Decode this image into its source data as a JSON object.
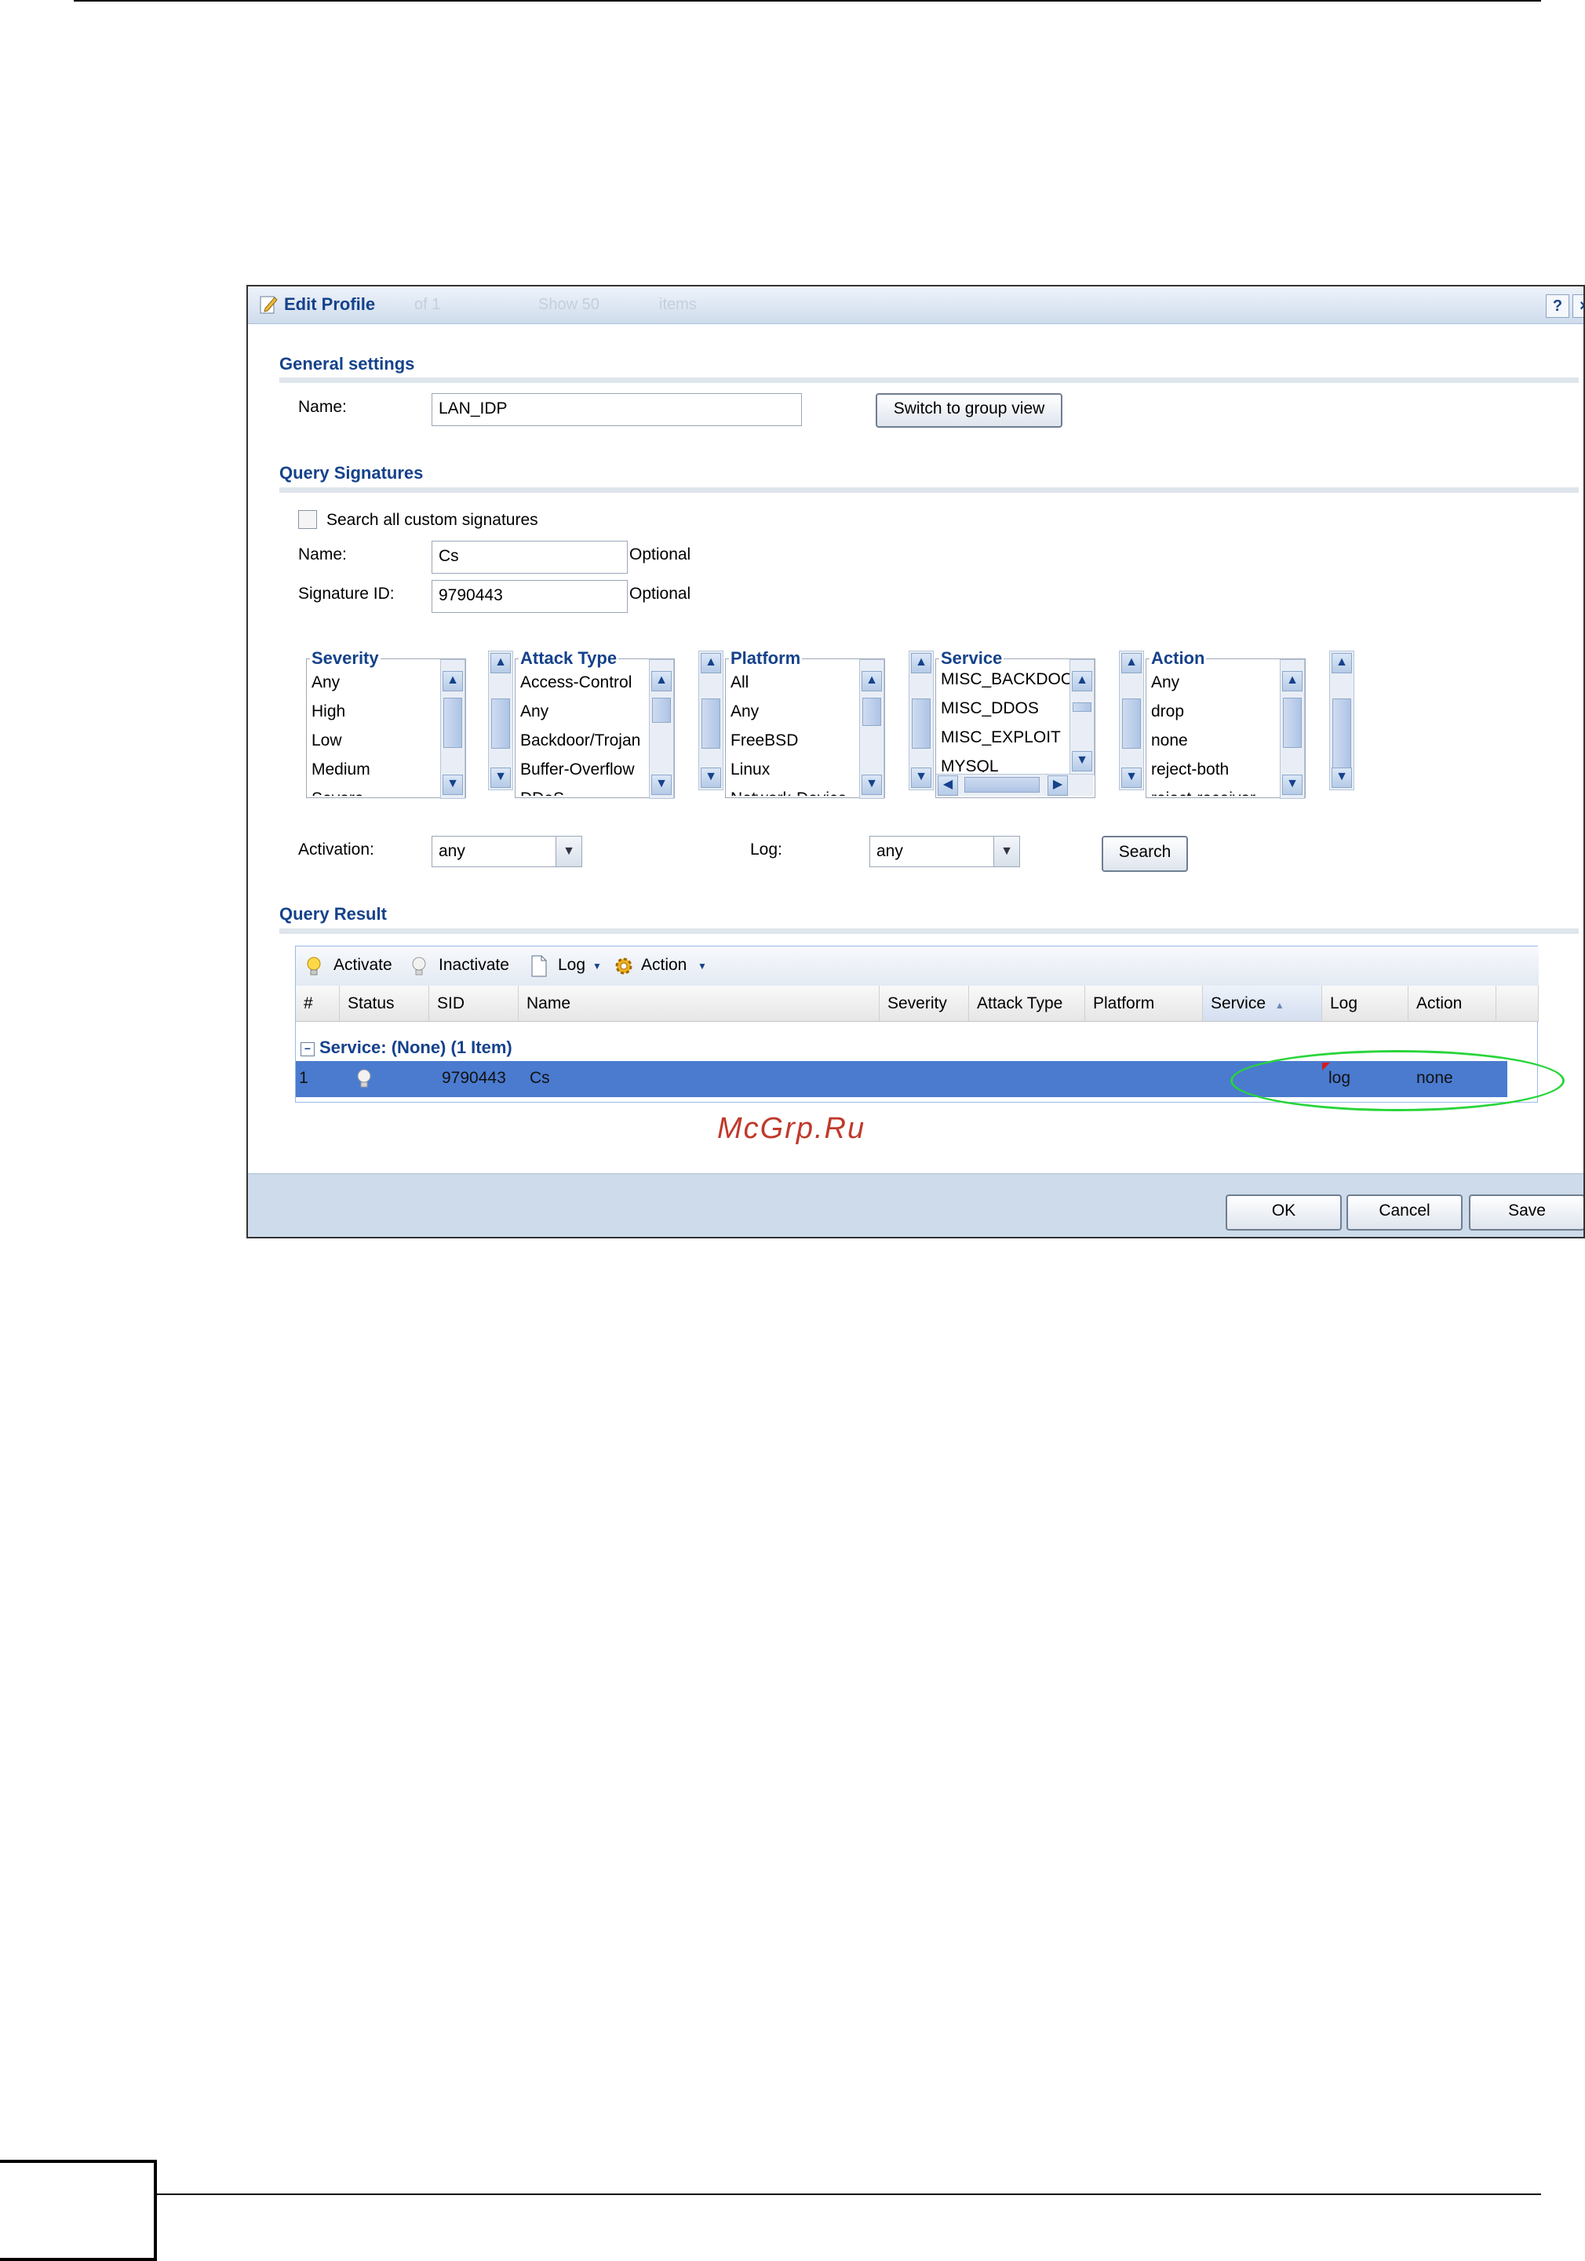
{
  "dialog": {
    "title": "Edit Profile",
    "ghost_paging": {
      "of": "of 1",
      "show": "Show 50",
      "items": "items"
    },
    "help": "?",
    "close": "×"
  },
  "general": {
    "title": "General settings",
    "name_label": "Name:",
    "name_value": "LAN_IDP",
    "switch_button": "Switch to group view"
  },
  "query": {
    "title": "Query Signatures",
    "search_custom_label": "Search all custom signatures",
    "name_label": "Name:",
    "name_value": "Cs",
    "name_hint": "Optional",
    "sid_label": "Signature ID:",
    "sid_value": "9790443",
    "sid_hint": "Optional",
    "lists": {
      "severity": {
        "title": "Severity",
        "options": [
          "Any",
          "High",
          "Low",
          "Medium",
          "Severe"
        ]
      },
      "attack_type": {
        "title": "Attack Type",
        "options": [
          "Access-Control",
          "Any",
          "Backdoor/Trojan",
          "Buffer-Overflow",
          "DDoS"
        ]
      },
      "platform": {
        "title": "Platform",
        "options": [
          "All",
          "Any",
          "FreeBSD",
          "Linux",
          "Network-Device"
        ]
      },
      "service": {
        "title": "Service",
        "options": [
          "MISC_BACKDOOR",
          "MISC_DDOS",
          "MISC_EXPLOIT",
          "MYSQL"
        ]
      },
      "action": {
        "title": "Action",
        "options": [
          "Any",
          "drop",
          "none",
          "reject-both",
          "reject-receiver"
        ]
      }
    },
    "activation_label": "Activation:",
    "activation_value": "any",
    "log_label": "Log:",
    "log_value": "any",
    "search_button": "Search"
  },
  "result": {
    "title": "Query Result",
    "toolbar": {
      "activate": "Activate",
      "inactivate": "Inactivate",
      "log": "Log",
      "action": "Action"
    },
    "columns": [
      "#",
      "Status",
      "SID",
      "Name",
      "Severity",
      "Attack Type",
      "Platform",
      "Service",
      "Log",
      "Action"
    ],
    "sorted_column": "Service",
    "group": "Service: (None) (1 Item)",
    "rows": [
      {
        "num": "1",
        "sid": "9790443",
        "name": "Cs",
        "log": "log",
        "action": "none"
      }
    ]
  },
  "footer": {
    "ok": "OK",
    "cancel": "Cancel",
    "save": "Save"
  },
  "watermark": "McGrp.Ru",
  "colors": {
    "accent": "#15428b",
    "row_selected": "#4a7bcf",
    "highlight_ellipse": "#29d53a",
    "watermark": "#c0392b"
  }
}
